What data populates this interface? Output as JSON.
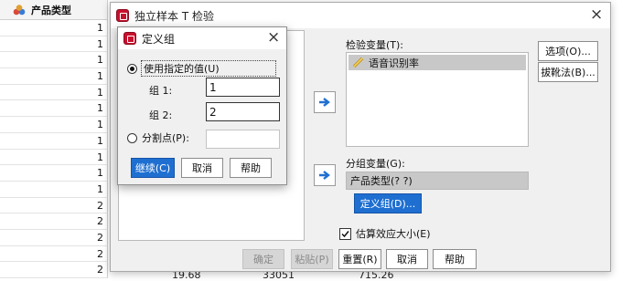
{
  "sheet": {
    "column_header": "产品类型",
    "row_values": [
      "1",
      "1",
      "1",
      "1",
      "1",
      "1",
      "1",
      "1",
      "1",
      "1",
      "1",
      "2",
      "2",
      "2",
      "2",
      "2"
    ],
    "bottom_row_values": [
      "19.68",
      "33051",
      "715.26"
    ]
  },
  "main_dialog": {
    "title": "独立样本 T 检验",
    "close_icon": "×",
    "test_var_label": "检验变量(T):",
    "test_var_items": [
      "语音识别率"
    ],
    "group_var_label": "分组变量(G):",
    "group_var_value": "产品类型(? ?)",
    "define_groups_button": "定义组(D)...",
    "options_button": "选项(O)...",
    "bootstrap_button": "拔靴法(B)...",
    "effect_size_label": "估算效应大小(E)",
    "effect_size_checked": true,
    "buttons": {
      "ok": "确定",
      "paste": "粘贴(P)",
      "reset": "重置(R)",
      "cancel": "取消",
      "help": "帮助"
    }
  },
  "define_groups_dialog": {
    "title": "定义组",
    "close_icon": "×",
    "use_specified_label": "使用指定的值(U)",
    "use_specified_selected": true,
    "group1_label": "组 1:",
    "group1_value": "1",
    "group2_label": "组 2:",
    "group2_value": "2",
    "cut_point_label": "分割点(P):",
    "cut_point_value": "",
    "buttons": {
      "continue": "继续(C)",
      "cancel": "取消",
      "help": "帮助"
    }
  },
  "colors": {
    "accent_blue": "#1f6fd1",
    "app_icon_red": "#c8102e",
    "selected_gray": "#c8c8c8"
  }
}
